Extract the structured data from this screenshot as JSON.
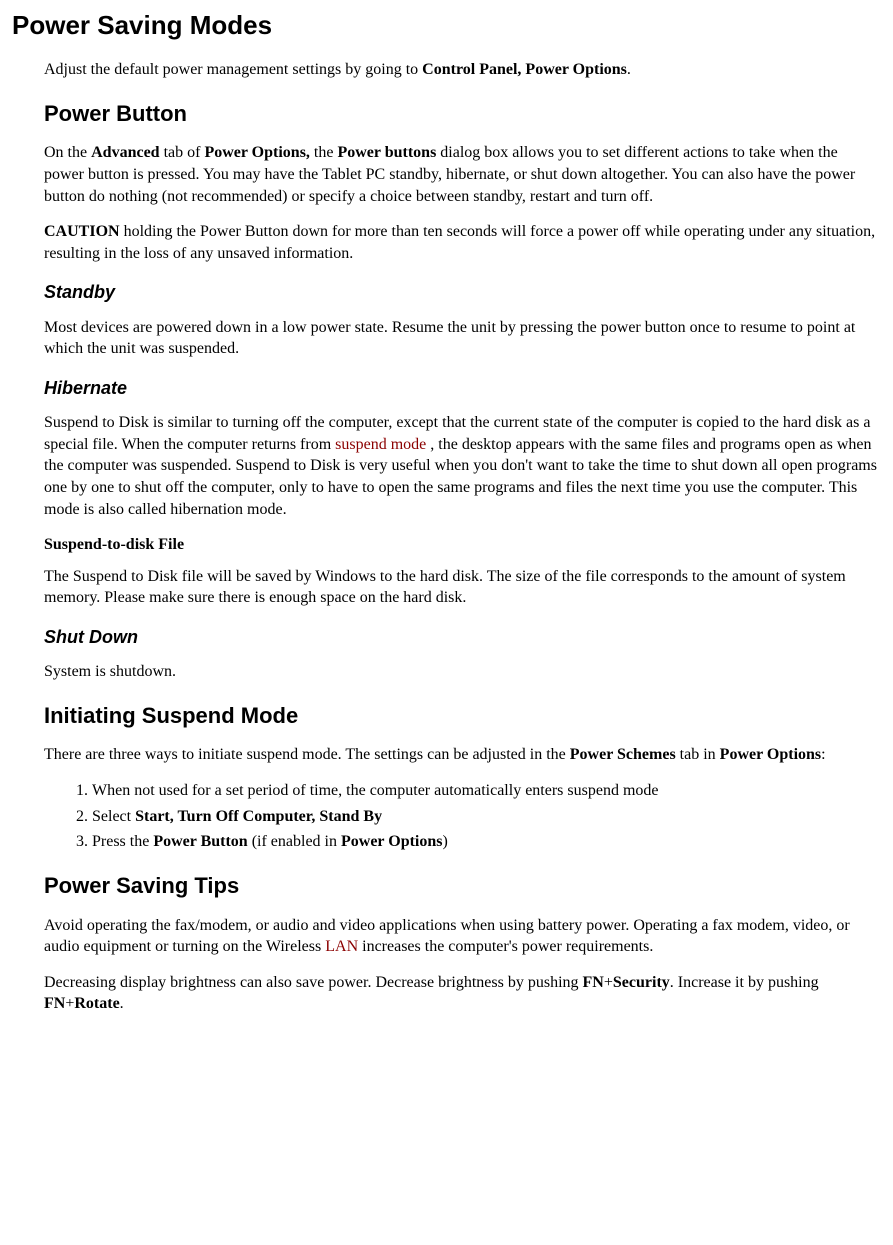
{
  "h1": "Power Saving Modes",
  "intro_a": "Adjust the default power management settings by going to ",
  "intro_b": "Control Panel, Power Options",
  "intro_c": ".",
  "pb_h": "Power Button",
  "pb_p_a": "On the ",
  "pb_p_b": "Advanced",
  "pb_p_c": " tab of ",
  "pb_p_d": "Power Options,",
  "pb_p_e": " the ",
  "pb_p_f": "Power buttons",
  "pb_p_g": " dialog box allows you to set different actions to take when the power button is pressed. You may have the Tablet PC standby, hibernate, or shut down altogether. You can also have the power button do nothing (not recommended) or specify a choice between standby, restart and turn off.",
  "caution_a": "CAUTION",
  "caution_b": "  holding the Power Button down for more than ten seconds will force a power off while operating under any situation, resulting in the loss of any unsaved information.",
  "sb_h": "Standby",
  "sb_p": "Most devices are powered down in a low power state.  Resume the unit by pressing the power button once to resume to point at which the unit was suspended.",
  "hib_h": "Hibernate",
  "hib_p_a": "Suspend to Disk is similar to turning off the computer, except that the current state of the computer is copied to the hard disk as a special file. When the computer returns from ",
  "hib_link": "suspend mode",
  "hib_p_b": " , the desktop appears with the same files and programs open as when the computer was suspended. Suspend to Disk is very useful when you don't want to take the time to shut down all open programs one by one to shut off the computer, only to have to open the same programs and files the next time you use the computer. This mode is also called hibernation mode.",
  "std_h": "Suspend-to-disk File",
  "std_p": "The Suspend to Disk file will be saved by Windows to the hard disk. The size of the file corresponds to the amount of system memory. Please make sure there is enough space on the hard disk.",
  "sd_h": "Shut Down",
  "sd_p": "System is shutdown.",
  "ism_h": "Initiating Suspend Mode",
  "ism_p_a": "There are three ways to initiate suspend mode. The settings can be adjusted in the ",
  "ism_p_b": "Power Schemes",
  "ism_p_c": " tab in ",
  "ism_p_d": "Power Options",
  "ism_p_e": ":",
  "list": {
    "i1": "When not used for a set period of time, the computer automatically enters suspend mode",
    "i2a": "Select ",
    "i2b": "Start, Turn Off Computer, Stand By",
    "i3a": "Press the ",
    "i3b": "Power Button",
    "i3c": " (if enabled in ",
    "i3d": "Power Options",
    "i3e": ")"
  },
  "pst_h": "Power Saving Tips",
  "pst_p1_a": "Avoid operating the fax/modem, or audio and video applications when using battery power. Operating a fax modem, video, or audio equipment or turning on the Wireless ",
  "pst_link": "LAN",
  "pst_p1_b": " increases the computer's power requirements.",
  "pst_p2_a": "Decreasing display brightness can also save power. Decrease brightness by pushing ",
  "pst_p2_b": "FN",
  "pst_p2_c": "+",
  "pst_p2_d": "Security",
  "pst_p2_e": ". Increase it by pushing ",
  "pst_p2_f": "FN",
  "pst_p2_g": "+",
  "pst_p2_h": "Rotate",
  "pst_p2_i": "."
}
